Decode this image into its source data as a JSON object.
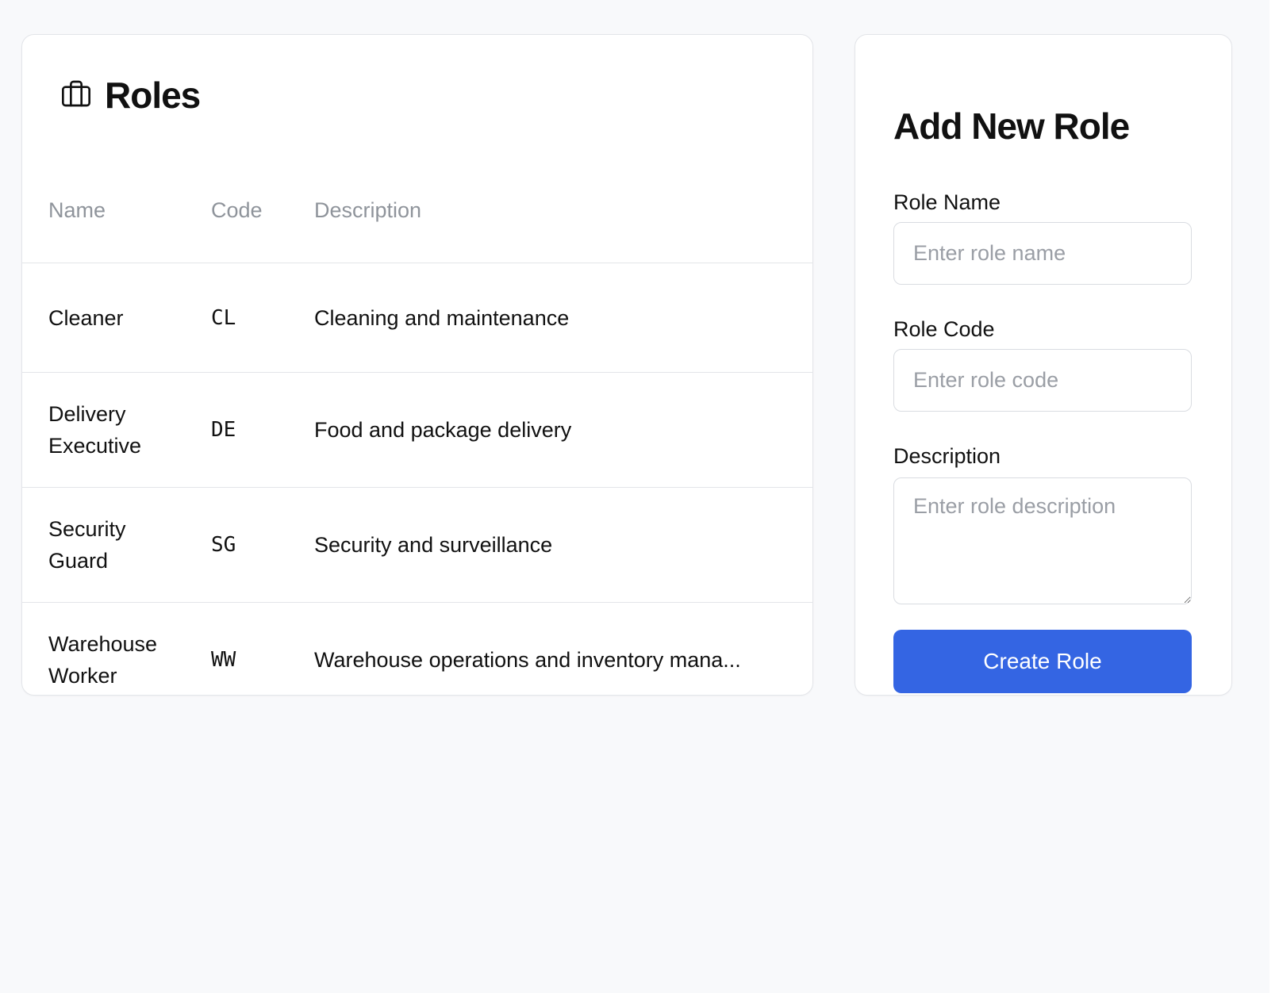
{
  "roles_panel": {
    "title": "Roles",
    "icon": "briefcase-icon",
    "columns": [
      "Name",
      "Code",
      "Description"
    ],
    "rows": [
      {
        "name": "Cleaner",
        "code": "CL",
        "description": "Cleaning and maintenance"
      },
      {
        "name": "Delivery Executive",
        "code": "DE",
        "description": "Food and package delivery"
      },
      {
        "name": "Security Guard",
        "code": "SG",
        "description": "Security and surveillance"
      },
      {
        "name": "Warehouse Worker",
        "code": "WW",
        "description": "Warehouse operations and inventory mana..."
      }
    ]
  },
  "form": {
    "title": "Add New Role",
    "role_name_label": "Role Name",
    "role_name_placeholder": "Enter role name",
    "role_code_label": "Role Code",
    "role_code_placeholder": "Enter role code",
    "description_label": "Description",
    "description_placeholder": "Enter role description",
    "submit_label": "Create Role"
  },
  "colors": {
    "accent": "#3465e3",
    "background": "#f8f9fb",
    "border": "#e3e5e9",
    "muted_text": "#8f949b"
  }
}
